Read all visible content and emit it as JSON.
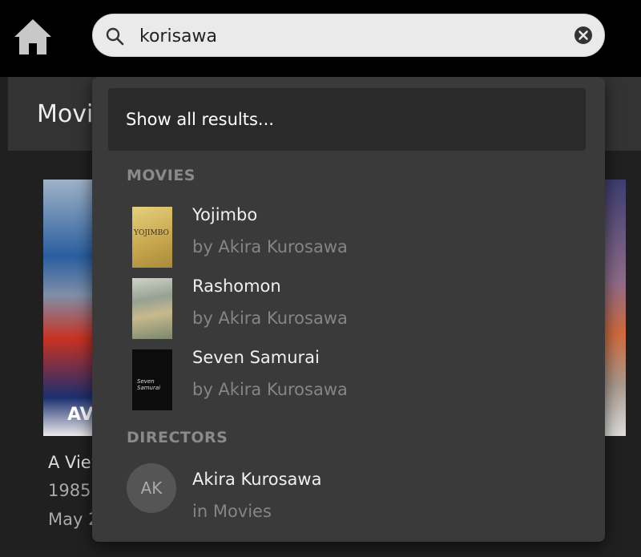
{
  "search": {
    "query": "korisawa"
  },
  "background": {
    "section_title": "Movi",
    "poster_text": "AV",
    "item_title": "A View",
    "item_year": "1985",
    "item_date": "May 2"
  },
  "dropdown": {
    "show_all_label": "Show all results...",
    "groups": {
      "movies": {
        "label": "MOVIES",
        "items": [
          {
            "title": "Yojimbo",
            "subtitle": "by Akira Kurosawa",
            "thumb_text": "YOJIMBO"
          },
          {
            "title": "Rashomon",
            "subtitle": "by Akira Kurosawa"
          },
          {
            "title": "Seven Samurai",
            "subtitle": "by Akira Kurosawa",
            "thumb_text": "Seven Samurai"
          }
        ]
      },
      "directors": {
        "label": "DIRECTORS",
        "items": [
          {
            "title": "Akira Kurosawa",
            "subtitle": "in Movies",
            "initials": "AK"
          }
        ]
      }
    }
  }
}
